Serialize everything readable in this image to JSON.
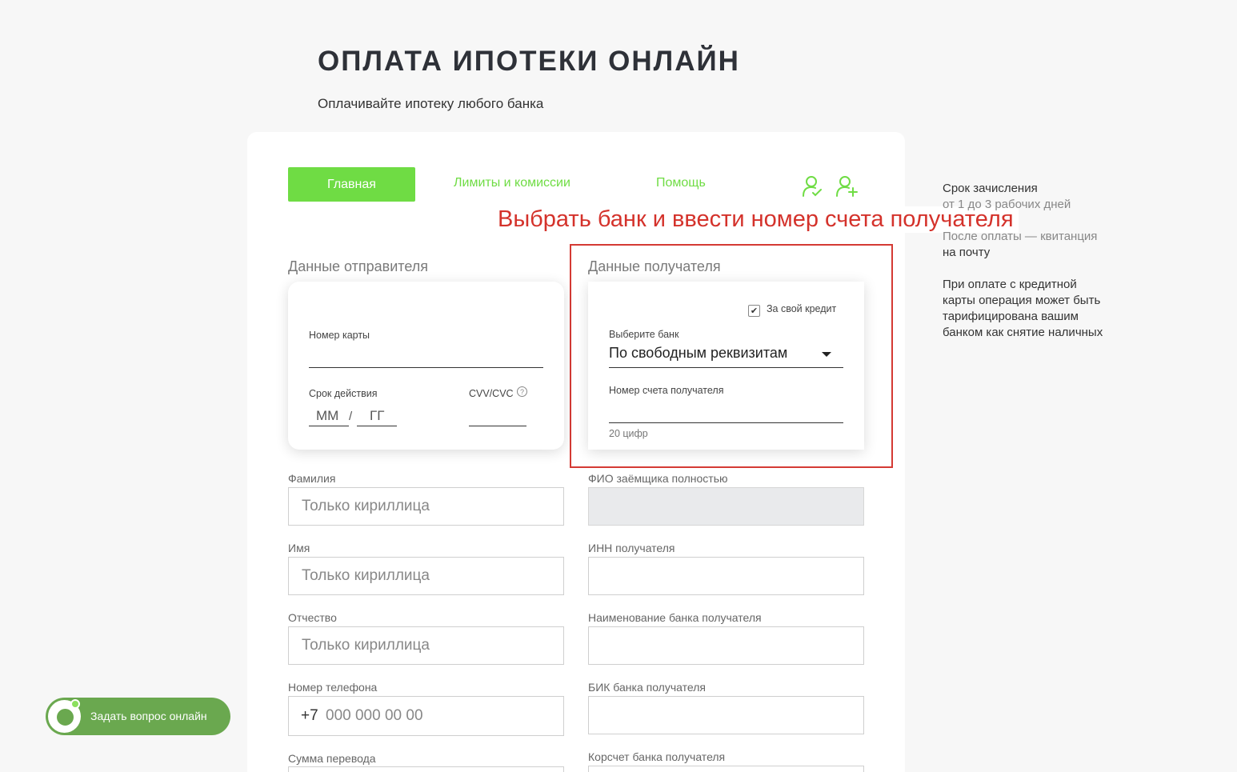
{
  "page": {
    "title": "ОПЛАТА ИПОТЕКИ ОНЛАЙН",
    "subtitle": "Оплачивайте ипотеку любого банка"
  },
  "nav": {
    "main": "Главная",
    "limits": "Лимиты и комиссии",
    "help": "Помощь",
    "icons": [
      "user-check-icon",
      "user-add-icon"
    ],
    "accent_color": "#6fdc44"
  },
  "annotation": {
    "text": "Выбрать банк  и ввести номер счета получателя",
    "color": "#d4322b"
  },
  "sender": {
    "title": "Данные отправителя",
    "card_number_label": "Номер карты",
    "expiry_label": "Срок действия",
    "month": "ММ",
    "separator": "/",
    "year": "ГГ",
    "cvv_label": "CVV/CVC",
    "help_symbol": "?"
  },
  "recipient": {
    "title": "Данные получателя",
    "own_credit_label": "За свой кредит",
    "own_credit_checked": true,
    "bank_select_label": "Выберите банк",
    "bank_select_value": "По свободным реквизитам",
    "account_label": "Номер счета получателя",
    "account_hint": "20 цифр"
  },
  "fields": {
    "surname": {
      "label": "Фамилия",
      "placeholder": "Только кириллица"
    },
    "name": {
      "label": "Имя",
      "placeholder": "Только кириллица"
    },
    "patronymic": {
      "label": "Отчество",
      "placeholder": "Только кириллица"
    },
    "phone": {
      "label": "Номер телефона",
      "prefix": "+7",
      "placeholder": "000 000 00 00"
    },
    "amount": {
      "label": "Сумма перевода"
    },
    "borrower": {
      "label": "ФИО заёмщика полностью"
    },
    "inn": {
      "label": "ИНН получателя"
    },
    "bank_name": {
      "label": "Наименование банка получателя"
    },
    "bik": {
      "label": "БИК банка получателя"
    },
    "corr": {
      "label": "Корсчет банка получателя"
    }
  },
  "info": {
    "line1": "Срок зачисления",
    "line2": "от 1 до 3 рабочих дней",
    "line3": "После оплаты — квитанция",
    "line4": "на почту",
    "line5": "При оплате с кредитной",
    "line6": "карты операция может быть",
    "line7": "тарифицирована вашим",
    "line8": "банком как снятие наличных"
  },
  "chat": {
    "label": "Задать вопрос онлайн"
  }
}
